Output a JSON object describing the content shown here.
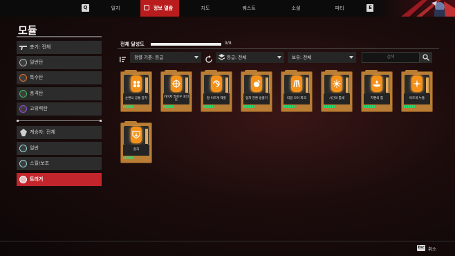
{
  "nav": {
    "left_key": "Q",
    "right_key": "E",
    "tabs": [
      {
        "label": "일지"
      },
      {
        "label": "정보 열람"
      },
      {
        "label": "지도"
      },
      {
        "label": "퀘스트"
      },
      {
        "label": "소셜"
      },
      {
        "label": "파티"
      }
    ],
    "active_tab": "정보 열람"
  },
  "page": {
    "title": "모듈"
  },
  "sidebar": {
    "group1": [
      {
        "label": "총기: 전체",
        "icon": "gun-icon"
      },
      {
        "label": "일반탄",
        "icon": "bullet-icon",
        "color": "#b5b5b5"
      },
      {
        "label": "특수탄",
        "icon": "special-ammo-icon",
        "color": "#e0742c"
      },
      {
        "label": "충격탄",
        "icon": "shock-ammo-icon",
        "color": "#3fbf5a"
      },
      {
        "label": "고위력탄",
        "icon": "high-power-ammo-icon",
        "color": "#9a4ad8"
      }
    ],
    "group2": [
      {
        "label": "계승자: 전체",
        "icon": "descendant-icon"
      },
      {
        "label": "일반",
        "icon": "general-icon"
      },
      {
        "label": "스킬/보조",
        "icon": "skill-icon"
      },
      {
        "label": "트리거",
        "icon": "trigger-icon",
        "selected": true
      }
    ]
  },
  "progress": {
    "label": "전체 달성도",
    "count_text": "9/8",
    "fraction": 1.0
  },
  "filters": {
    "sort": "정렬 기준: 등급",
    "grade": "등급: 전체",
    "owned": "보유: 전체",
    "search_placeholder": "검색"
  },
  "modules": [
    {
      "name": "순환식 공통 장치",
      "icon": "cluster-icon"
    },
    {
      "name": "카이저 팔로우 포인트",
      "icon": "crosshair-icon"
    },
    {
      "name": "잘 어르게 재킷",
      "icon": "swirl-icon"
    },
    {
      "name": "업자 전환 방출기",
      "icon": "emitter-icon"
    },
    {
      "name": "티끌 모아 파괴",
      "icon": "claw-icon"
    },
    {
      "name": "시간의 톱새",
      "icon": "burst-icon"
    },
    {
      "name": "저편의 힘",
      "icon": "hand-icon"
    },
    {
      "name": "아르게 누출",
      "icon": "sparkle-icon"
    },
    {
      "name": "충차",
      "icon": "shield-arrow-icon"
    }
  ],
  "footer": {
    "esc_key": "Esc",
    "cancel_label": "취소"
  },
  "colors": {
    "accent_red": "#c2262c",
    "card_orange": "#f4911a",
    "card_frame": "#b97d35",
    "stack_green": "#39d16a"
  }
}
